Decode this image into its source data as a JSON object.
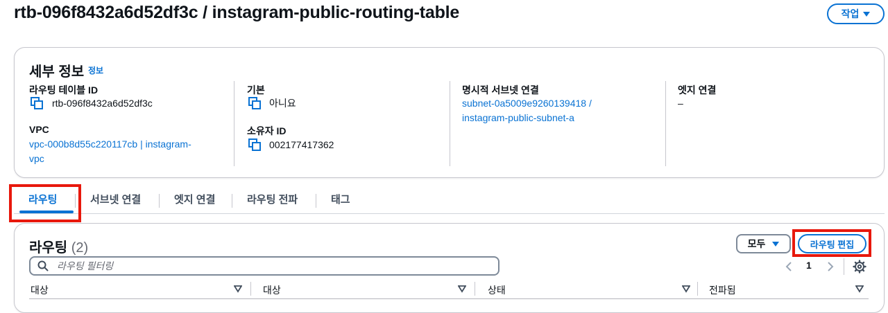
{
  "header": {
    "title": "rtb-096f8432a6d52df3c / instagram-public-routing-table",
    "actions_label": "작업"
  },
  "details": {
    "title": "세부 정보",
    "info_label": "정보",
    "route_table_id_label": "라우팅 테이블 ID",
    "route_table_id": "rtb-096f8432a6d52df3c",
    "vpc_label": "VPC",
    "vpc_line1": "vpc-000b8d55c220117cb | instagram-",
    "vpc_line2": "vpc",
    "main_label": "기본",
    "main_value": "아니요",
    "owner_label": "소유자 ID",
    "owner_value": "002177417362",
    "explicit_subnet_label": "명시적 서브넷 연결",
    "explicit_subnet_line1": "subnet-0a5009e9260139418 /",
    "explicit_subnet_line2": "instagram-public-subnet-a",
    "edge_label": "엣지 연결",
    "edge_value": "–"
  },
  "tabs": [
    {
      "label": "라우팅",
      "active": true
    },
    {
      "label": "서브넷 연결",
      "active": false
    },
    {
      "label": "엣지 연결",
      "active": false
    },
    {
      "label": "라우팅 전파",
      "active": false
    },
    {
      "label": "태그",
      "active": false
    }
  ],
  "routes": {
    "title": "라우팅",
    "count": "(2)",
    "filter_value": "모두",
    "edit_label": "라우팅 편집",
    "search_placeholder": "라우팅 필터링",
    "page": "1",
    "columns": [
      "대상",
      "대상",
      "상태",
      "전파됨"
    ]
  },
  "colors": {
    "accent": "#0972d3",
    "highlight": "#e8180c",
    "text": "#0f141a",
    "border": "#c6c6cd"
  },
  "icons": [
    "copy-icon",
    "caret-down-icon",
    "search-icon",
    "chevron-left-icon",
    "chevron-right-icon",
    "settings-icon",
    "sort-icon"
  ]
}
